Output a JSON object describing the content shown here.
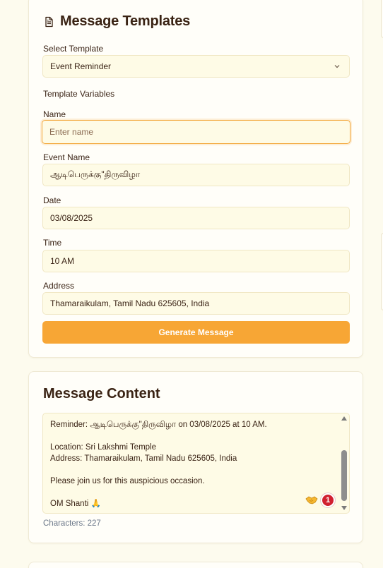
{
  "templates_card": {
    "title": "Message Templates",
    "title_icon": "document-icon",
    "select_template_label": "Select Template",
    "selected_template": "Event Reminder",
    "variables_heading": "Template Variables",
    "fields": {
      "name": {
        "label": "Name",
        "value": "",
        "placeholder": "Enter name"
      },
      "event_name": {
        "label": "Event Name",
        "value": "ஆடிபெருக்கு\"திருவிழா"
      },
      "date": {
        "label": "Date",
        "value": "03/08/2025"
      },
      "time": {
        "label": "Time",
        "value": "10 AM"
      },
      "address": {
        "label": "Address",
        "value": "Thamaraikulam, Tamil Nadu 625605, India"
      }
    },
    "generate_button": "Generate Message"
  },
  "content_card": {
    "title": "Message Content",
    "message": "Reminder: ஆடிபெருக்கு\"திருவிழா on 03/08/2025 at 10 AM.\n\nLocation: Sri Lakshmi Temple\nAddress: Thamaraikulam, Tamil Nadu 625605, India\n\nPlease join us for this auspicious occasion.\n\nOM Shanti 🙏",
    "extension_badge_count": "1",
    "characters": "Characters: 227"
  },
  "colors": {
    "accent": "#f7a635",
    "background": "#fdfbee",
    "field_bg": "#fefbe6",
    "badge": "#d11f2f"
  }
}
